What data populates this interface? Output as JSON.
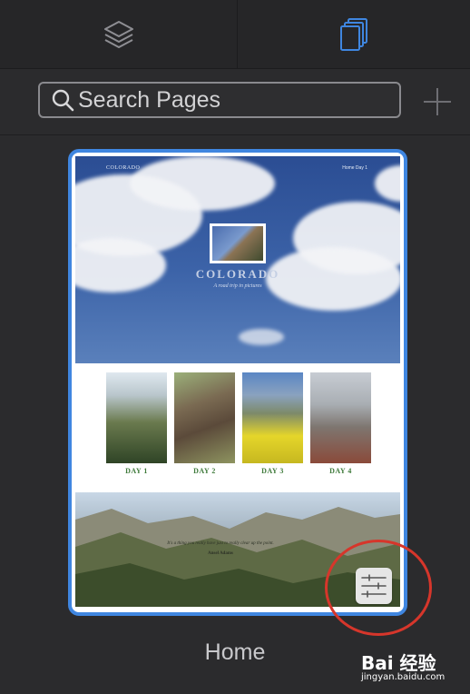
{
  "tabs": [
    {
      "icon": "layers-icon",
      "active": false
    },
    {
      "icon": "pages-icon",
      "active": true
    }
  ],
  "search": {
    "placeholder": "Search Pages",
    "value": ""
  },
  "add_button_icon": "plus-icon",
  "colors": {
    "accent": "#3f86e0",
    "panel_bg": "#2b2b2d",
    "highlight_ring": "#d6362b"
  },
  "page": {
    "name": "Home",
    "thumbnail": {
      "brand": "COLORADO",
      "nav": "Home    Day 1",
      "title": "COLORADO",
      "subtitle": "A road trip in pictures",
      "days": [
        {
          "label": "DAY 1"
        },
        {
          "label": "DAY 2"
        },
        {
          "label": "DAY 3"
        },
        {
          "label": "DAY 4"
        }
      ],
      "quote": "It's a thing you really have just to really clear up the point.",
      "quote_author": "Ansel Adams"
    },
    "settings_icon": "sliders-icon"
  },
  "watermark": {
    "text": "Bai 经验",
    "url": "jingyan.baidu.com"
  }
}
